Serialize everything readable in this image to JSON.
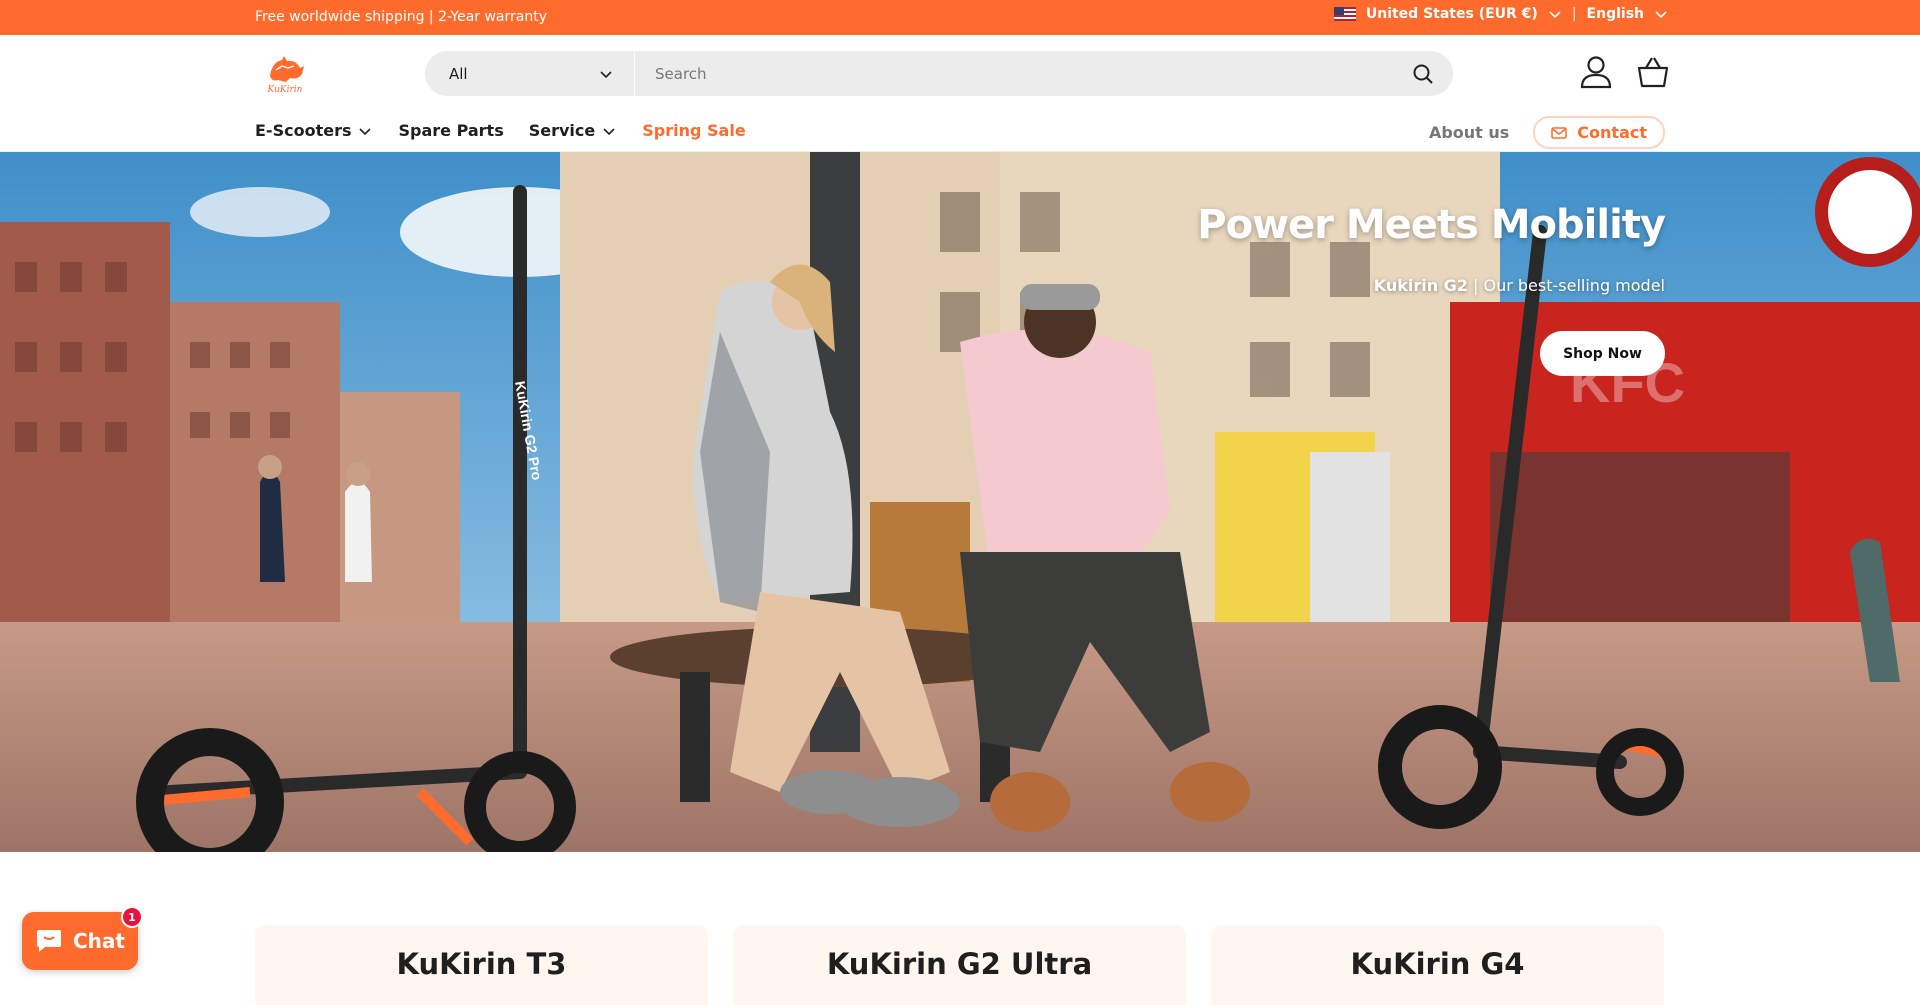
{
  "announcement": {
    "message": "Free worldwide shipping | 2-Year warranty",
    "country": "United States (EUR €)",
    "separator": "|",
    "language": "English"
  },
  "header": {
    "logo_text": "KuKirin",
    "search": {
      "category": "All",
      "placeholder": "Search"
    },
    "nav": {
      "e_scooters": "E-Scooters",
      "spare_parts": "Spare Parts",
      "service": "Service",
      "spring_sale": "Spring Sale",
      "about": "About us",
      "contact": "Contact"
    }
  },
  "hero": {
    "title": "Power Meets Mobility",
    "subtitle_bold": "Kukirin G2",
    "subtitle_rest": " | Our best-selling model",
    "cta": "Shop Now",
    "scene_text": {
      "scooter_label": "KuKirin G2 Pro",
      "store_label": "KFC"
    }
  },
  "products": [
    {
      "name": "KuKirin T3"
    },
    {
      "name": "KuKirin G2 Ultra"
    },
    {
      "name": "KuKirin G4"
    }
  ],
  "chat": {
    "label": "Chat",
    "badge_count": "1"
  },
  "colors": {
    "accent": "#ff6b2c",
    "badge": "#e8123d"
  }
}
